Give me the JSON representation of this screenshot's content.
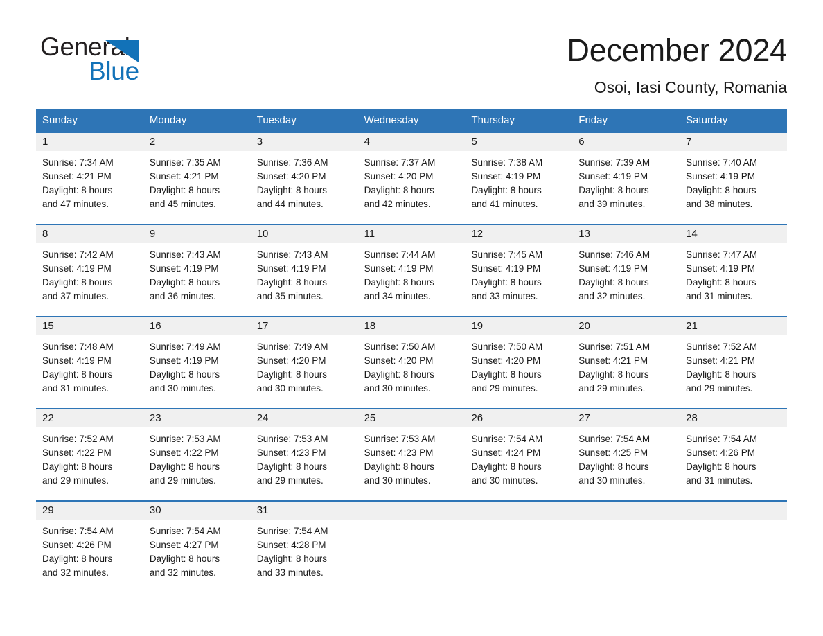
{
  "brand": {
    "name_part1": "General",
    "name_part2": "Blue",
    "triangle_icon": "triangle-icon",
    "accent_color": "#1272b8"
  },
  "header": {
    "title": "December 2024",
    "location": "Osoi, Iasi County, Romania"
  },
  "colors": {
    "header_blue": "#2e75b6",
    "row_band_gray": "#f0f0f0",
    "text": "#1a1a1a"
  },
  "weekdays": [
    "Sunday",
    "Monday",
    "Tuesday",
    "Wednesday",
    "Thursday",
    "Friday",
    "Saturday"
  ],
  "weeks": [
    [
      {
        "day": "1",
        "sunrise": "Sunrise: 7:34 AM",
        "sunset": "Sunset: 4:21 PM",
        "daylight_line1": "Daylight: 8 hours",
        "daylight_line2": "and 47 minutes."
      },
      {
        "day": "2",
        "sunrise": "Sunrise: 7:35 AM",
        "sunset": "Sunset: 4:21 PM",
        "daylight_line1": "Daylight: 8 hours",
        "daylight_line2": "and 45 minutes."
      },
      {
        "day": "3",
        "sunrise": "Sunrise: 7:36 AM",
        "sunset": "Sunset: 4:20 PM",
        "daylight_line1": "Daylight: 8 hours",
        "daylight_line2": "and 44 minutes."
      },
      {
        "day": "4",
        "sunrise": "Sunrise: 7:37 AM",
        "sunset": "Sunset: 4:20 PM",
        "daylight_line1": "Daylight: 8 hours",
        "daylight_line2": "and 42 minutes."
      },
      {
        "day": "5",
        "sunrise": "Sunrise: 7:38 AM",
        "sunset": "Sunset: 4:19 PM",
        "daylight_line1": "Daylight: 8 hours",
        "daylight_line2": "and 41 minutes."
      },
      {
        "day": "6",
        "sunrise": "Sunrise: 7:39 AM",
        "sunset": "Sunset: 4:19 PM",
        "daylight_line1": "Daylight: 8 hours",
        "daylight_line2": "and 39 minutes."
      },
      {
        "day": "7",
        "sunrise": "Sunrise: 7:40 AM",
        "sunset": "Sunset: 4:19 PM",
        "daylight_line1": "Daylight: 8 hours",
        "daylight_line2": "and 38 minutes."
      }
    ],
    [
      {
        "day": "8",
        "sunrise": "Sunrise: 7:42 AM",
        "sunset": "Sunset: 4:19 PM",
        "daylight_line1": "Daylight: 8 hours",
        "daylight_line2": "and 37 minutes."
      },
      {
        "day": "9",
        "sunrise": "Sunrise: 7:43 AM",
        "sunset": "Sunset: 4:19 PM",
        "daylight_line1": "Daylight: 8 hours",
        "daylight_line2": "and 36 minutes."
      },
      {
        "day": "10",
        "sunrise": "Sunrise: 7:43 AM",
        "sunset": "Sunset: 4:19 PM",
        "daylight_line1": "Daylight: 8 hours",
        "daylight_line2": "and 35 minutes."
      },
      {
        "day": "11",
        "sunrise": "Sunrise: 7:44 AM",
        "sunset": "Sunset: 4:19 PM",
        "daylight_line1": "Daylight: 8 hours",
        "daylight_line2": "and 34 minutes."
      },
      {
        "day": "12",
        "sunrise": "Sunrise: 7:45 AM",
        "sunset": "Sunset: 4:19 PM",
        "daylight_line1": "Daylight: 8 hours",
        "daylight_line2": "and 33 minutes."
      },
      {
        "day": "13",
        "sunrise": "Sunrise: 7:46 AM",
        "sunset": "Sunset: 4:19 PM",
        "daylight_line1": "Daylight: 8 hours",
        "daylight_line2": "and 32 minutes."
      },
      {
        "day": "14",
        "sunrise": "Sunrise: 7:47 AM",
        "sunset": "Sunset: 4:19 PM",
        "daylight_line1": "Daylight: 8 hours",
        "daylight_line2": "and 31 minutes."
      }
    ],
    [
      {
        "day": "15",
        "sunrise": "Sunrise: 7:48 AM",
        "sunset": "Sunset: 4:19 PM",
        "daylight_line1": "Daylight: 8 hours",
        "daylight_line2": "and 31 minutes."
      },
      {
        "day": "16",
        "sunrise": "Sunrise: 7:49 AM",
        "sunset": "Sunset: 4:19 PM",
        "daylight_line1": "Daylight: 8 hours",
        "daylight_line2": "and 30 minutes."
      },
      {
        "day": "17",
        "sunrise": "Sunrise: 7:49 AM",
        "sunset": "Sunset: 4:20 PM",
        "daylight_line1": "Daylight: 8 hours",
        "daylight_line2": "and 30 minutes."
      },
      {
        "day": "18",
        "sunrise": "Sunrise: 7:50 AM",
        "sunset": "Sunset: 4:20 PM",
        "daylight_line1": "Daylight: 8 hours",
        "daylight_line2": "and 30 minutes."
      },
      {
        "day": "19",
        "sunrise": "Sunrise: 7:50 AM",
        "sunset": "Sunset: 4:20 PM",
        "daylight_line1": "Daylight: 8 hours",
        "daylight_line2": "and 29 minutes."
      },
      {
        "day": "20",
        "sunrise": "Sunrise: 7:51 AM",
        "sunset": "Sunset: 4:21 PM",
        "daylight_line1": "Daylight: 8 hours",
        "daylight_line2": "and 29 minutes."
      },
      {
        "day": "21",
        "sunrise": "Sunrise: 7:52 AM",
        "sunset": "Sunset: 4:21 PM",
        "daylight_line1": "Daylight: 8 hours",
        "daylight_line2": "and 29 minutes."
      }
    ],
    [
      {
        "day": "22",
        "sunrise": "Sunrise: 7:52 AM",
        "sunset": "Sunset: 4:22 PM",
        "daylight_line1": "Daylight: 8 hours",
        "daylight_line2": "and 29 minutes."
      },
      {
        "day": "23",
        "sunrise": "Sunrise: 7:53 AM",
        "sunset": "Sunset: 4:22 PM",
        "daylight_line1": "Daylight: 8 hours",
        "daylight_line2": "and 29 minutes."
      },
      {
        "day": "24",
        "sunrise": "Sunrise: 7:53 AM",
        "sunset": "Sunset: 4:23 PM",
        "daylight_line1": "Daylight: 8 hours",
        "daylight_line2": "and 29 minutes."
      },
      {
        "day": "25",
        "sunrise": "Sunrise: 7:53 AM",
        "sunset": "Sunset: 4:23 PM",
        "daylight_line1": "Daylight: 8 hours",
        "daylight_line2": "and 30 minutes."
      },
      {
        "day": "26",
        "sunrise": "Sunrise: 7:54 AM",
        "sunset": "Sunset: 4:24 PM",
        "daylight_line1": "Daylight: 8 hours",
        "daylight_line2": "and 30 minutes."
      },
      {
        "day": "27",
        "sunrise": "Sunrise: 7:54 AM",
        "sunset": "Sunset: 4:25 PM",
        "daylight_line1": "Daylight: 8 hours",
        "daylight_line2": "and 30 minutes."
      },
      {
        "day": "28",
        "sunrise": "Sunrise: 7:54 AM",
        "sunset": "Sunset: 4:26 PM",
        "daylight_line1": "Daylight: 8 hours",
        "daylight_line2": "and 31 minutes."
      }
    ],
    [
      {
        "day": "29",
        "sunrise": "Sunrise: 7:54 AM",
        "sunset": "Sunset: 4:26 PM",
        "daylight_line1": "Daylight: 8 hours",
        "daylight_line2": "and 32 minutes."
      },
      {
        "day": "30",
        "sunrise": "Sunrise: 7:54 AM",
        "sunset": "Sunset: 4:27 PM",
        "daylight_line1": "Daylight: 8 hours",
        "daylight_line2": "and 32 minutes."
      },
      {
        "day": "31",
        "sunrise": "Sunrise: 7:54 AM",
        "sunset": "Sunset: 4:28 PM",
        "daylight_line1": "Daylight: 8 hours",
        "daylight_line2": "and 33 minutes."
      },
      {
        "day": "",
        "sunrise": "",
        "sunset": "",
        "daylight_line1": "",
        "daylight_line2": ""
      },
      {
        "day": "",
        "sunrise": "",
        "sunset": "",
        "daylight_line1": "",
        "daylight_line2": ""
      },
      {
        "day": "",
        "sunrise": "",
        "sunset": "",
        "daylight_line1": "",
        "daylight_line2": ""
      },
      {
        "day": "",
        "sunrise": "",
        "sunset": "",
        "daylight_line1": "",
        "daylight_line2": ""
      }
    ]
  ]
}
